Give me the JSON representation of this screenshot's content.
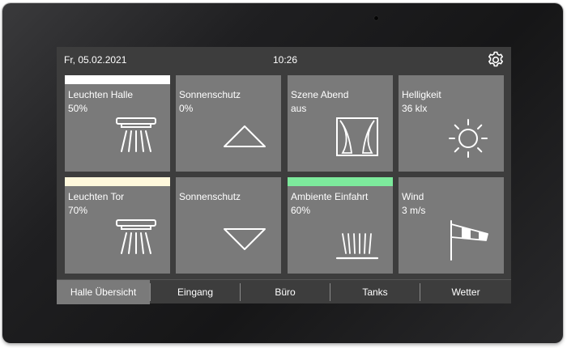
{
  "status": {
    "date": "Fr, 05.02.2021",
    "time": "10:26",
    "settings_icon": "gear-icon"
  },
  "tiles": [
    {
      "label": "Leuchten Halle",
      "value": "50%",
      "icon": "ceiling-light-icon",
      "indicator_color": "#ffffff"
    },
    {
      "label": "Sonnenschutz",
      "value": "0%",
      "icon": "arrow-up-icon"
    },
    {
      "label": "Szene Abend",
      "value": "aus",
      "icon": "curtains-icon"
    },
    {
      "label": "Helligkeit",
      "value": "36 klx",
      "icon": "sun-icon"
    },
    {
      "label": "Leuchten Tor",
      "value": "70%",
      "icon": "ceiling-light-icon",
      "indicator_color": "#fff8dc"
    },
    {
      "label": "Sonnenschutz",
      "value": "",
      "icon": "arrow-down-icon"
    },
    {
      "label": "Ambiente Einfahrt",
      "value": "60%",
      "icon": "ambient-light-icon",
      "indicator_color": "#7dea9c"
    },
    {
      "label": "Wind",
      "value": "3 m/s",
      "icon": "windsock-icon"
    }
  ],
  "nav": {
    "active_index": 0,
    "tabs": [
      "Halle Übersicht",
      "Eingang",
      "Büro",
      "Tanks",
      "Wetter"
    ]
  },
  "colors": {
    "tile_bg": "#7a7a7a",
    "screen_bg": "#3d3d3d",
    "bezel": "#1f1f21"
  }
}
